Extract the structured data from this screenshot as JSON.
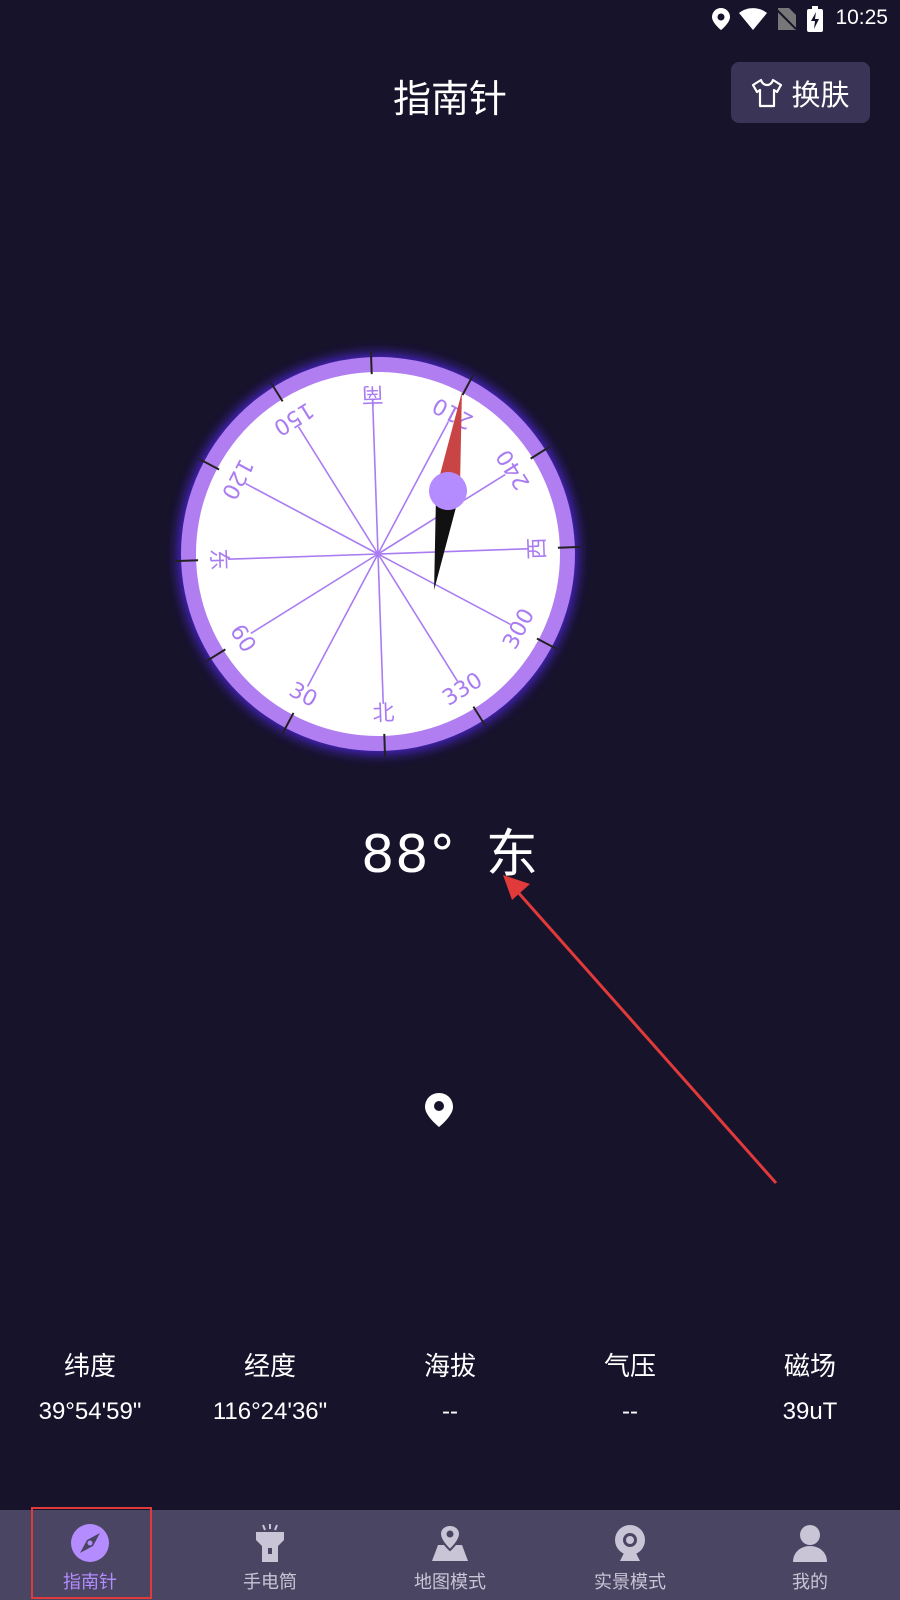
{
  "status_bar": {
    "time": "10:25",
    "icons": [
      "location-icon",
      "wifi-icon",
      "no-sim-icon",
      "battery-charging-icon"
    ]
  },
  "header": {
    "title": "指南针",
    "skin_button": {
      "label": "换肤",
      "icon": "tshirt-icon"
    }
  },
  "compass": {
    "dial_labels": [
      "东",
      "120",
      "150",
      "南",
      "210",
      "240",
      "西",
      "300",
      "330",
      "北",
      "30",
      "60"
    ],
    "needle_north_color": "#c94444",
    "needle_south_color": "#111111",
    "accent": "#a97cf2"
  },
  "heading": {
    "degrees": "88°",
    "direction": "东"
  },
  "info": {
    "items": [
      {
        "label": "纬度",
        "value": "39°54'59\""
      },
      {
        "label": "经度",
        "value": "116°24'36\""
      },
      {
        "label": "海拔",
        "value": "--"
      },
      {
        "label": "气压",
        "value": "--"
      },
      {
        "label": "磁场",
        "value": "39uT"
      }
    ]
  },
  "nav": {
    "items": [
      {
        "label": "指南针",
        "icon": "compass-icon",
        "active": true
      },
      {
        "label": "手电筒",
        "icon": "flashlight-icon",
        "active": false
      },
      {
        "label": "地图模式",
        "icon": "map-icon",
        "active": false
      },
      {
        "label": "实景模式",
        "icon": "camera-icon",
        "active": false
      },
      {
        "label": "我的",
        "icon": "user-icon",
        "active": false
      }
    ]
  },
  "colors": {
    "background": "#17132b",
    "nav_background": "#4a4562",
    "active": "#b48cff",
    "annotation": "#e03a3a"
  }
}
